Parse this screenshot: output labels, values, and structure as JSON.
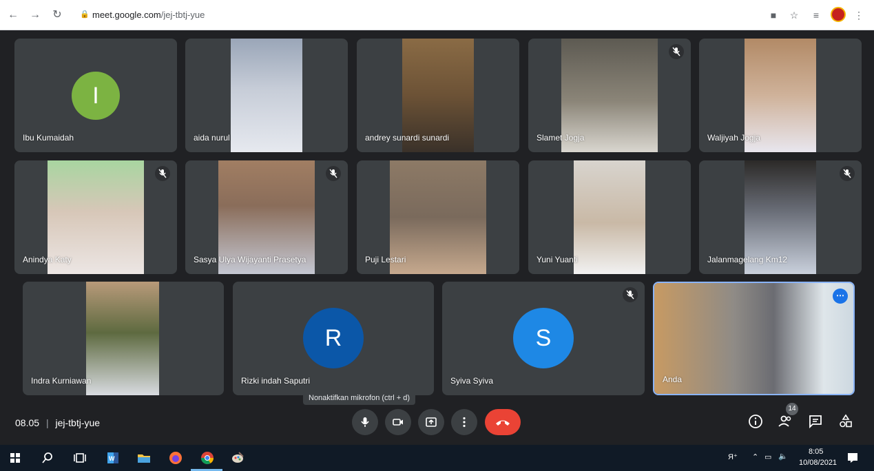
{
  "browser": {
    "url_host": "meet.google.com",
    "url_path": "/jej-tbtj-yue"
  },
  "participants": [
    {
      "name": "Ibu Kumaidah",
      "avatar_letter": "I",
      "avatar_color": "#7cb342",
      "muted": false
    },
    {
      "name": "aida nurul",
      "muted": false
    },
    {
      "name": "andrey sunardi sunardi",
      "muted": false
    },
    {
      "name": "Slamet Jogja",
      "muted": true
    },
    {
      "name": "Waljiyah Jogja",
      "muted": false
    },
    {
      "name": "Anindya Katy",
      "muted": true
    },
    {
      "name": "Sasya Ulya Wijayanti Prasetya",
      "muted": true
    },
    {
      "name": "Puji Lestari",
      "muted": false
    },
    {
      "name": "Yuni Yuanti",
      "muted": false
    },
    {
      "name": "Jalanmagelang Km12",
      "muted": true
    },
    {
      "name": "Indra Kurniawan",
      "muted": false
    },
    {
      "name": "Rizki indah Saputri",
      "avatar_letter": "R",
      "avatar_color": "#0b57a8",
      "muted": false
    },
    {
      "name": "Syiva Syiva",
      "avatar_letter": "S",
      "avatar_color": "#1e88e5",
      "muted": true
    },
    {
      "name": "Anda",
      "muted": false,
      "self": true
    }
  ],
  "tooltip": "Nonaktifkan mikrofon (ctrl + d)",
  "meeting": {
    "time": "08.05",
    "separator": "|",
    "code": "jej-tbtj-yue"
  },
  "controls": {
    "participants_count": "14"
  },
  "taskbar": {
    "clock_time": "8:05",
    "clock_date": "10/08/2021"
  },
  "colors": {
    "background": "#202124",
    "tile": "#3c4043",
    "end_call": "#ea4335",
    "self_border": "#8ab4f8"
  }
}
